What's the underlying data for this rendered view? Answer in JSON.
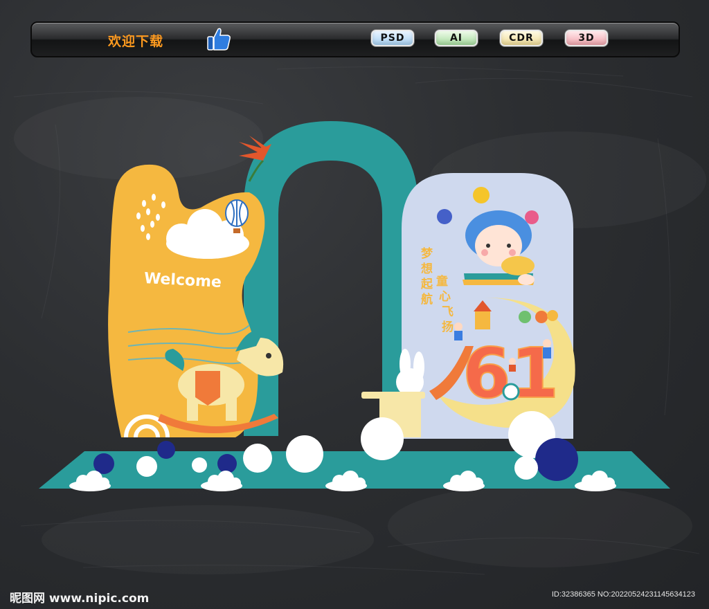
{
  "toolbar": {
    "welcome_text": "欢迎下载",
    "thumb_icon": "thumbs-up-icon",
    "buttons": [
      {
        "label": "PSD",
        "color": "#a9d2f3"
      },
      {
        "label": "AI",
        "color": "#a7dca0"
      },
      {
        "label": "CDR",
        "color": "#f0dc98"
      },
      {
        "label": "3D",
        "color": "#f1a6ae"
      }
    ]
  },
  "artwork": {
    "welcome": "Welcome",
    "slogan_left": "梦想起航",
    "slogan_right": "童心飞扬",
    "big_number": "61",
    "colors": {
      "teal": "#2a9c9b",
      "yellow": "#f5b840",
      "panel": "#cfd9ee",
      "navy": "#1f2a8a",
      "orange": "#f07a3a"
    }
  },
  "footer": {
    "logo": "昵图网 www.nipic.com",
    "id": "ID:32386365 NO:20220524231145634123"
  }
}
